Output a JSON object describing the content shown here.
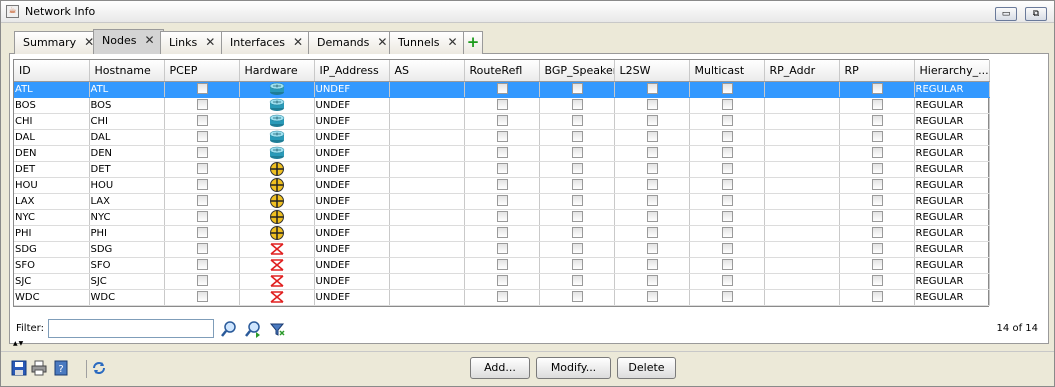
{
  "window": {
    "title": "Network Info",
    "minimize_label": "▭",
    "restore_label": "⧉"
  },
  "tabs": [
    {
      "label": "Summary",
      "close": "✕"
    },
    {
      "label": "Nodes",
      "close": "✕"
    },
    {
      "label": "Links",
      "close": "✕"
    },
    {
      "label": "Interfaces",
      "close": "✕"
    },
    {
      "label": "Demands",
      "close": "✕"
    },
    {
      "label": "Tunnels",
      "close": "✕"
    }
  ],
  "add_tab_label": "+",
  "table": {
    "columns": [
      "ID",
      "Hostname",
      "PCEP",
      "Hardware",
      "IP_Address",
      "AS",
      "RouteRefl",
      "BGP_Speaker",
      "L2SW",
      "Multicast",
      "RP_Addr",
      "RP",
      "Hierarchy_..."
    ],
    "rows": [
      {
        "id": "ATL",
        "hostname": "ATL",
        "hardware": "router-icon",
        "ip": "UNDEF",
        "hierarchy": "REGULAR",
        "selected": true
      },
      {
        "id": "BOS",
        "hostname": "BOS",
        "hardware": "router-icon",
        "ip": "UNDEF",
        "hierarchy": "REGULAR"
      },
      {
        "id": "CHI",
        "hostname": "CHI",
        "hardware": "router-icon",
        "ip": "UNDEF",
        "hierarchy": "REGULAR"
      },
      {
        "id": "DAL",
        "hostname": "DAL",
        "hardware": "router-icon",
        "ip": "UNDEF",
        "hierarchy": "REGULAR"
      },
      {
        "id": "DEN",
        "hostname": "DEN",
        "hardware": "router-icon",
        "ip": "UNDEF",
        "hierarchy": "REGULAR"
      },
      {
        "id": "DET",
        "hostname": "DET",
        "hardware": "crosshair-icon",
        "ip": "UNDEF",
        "hierarchy": "REGULAR"
      },
      {
        "id": "HOU",
        "hostname": "HOU",
        "hardware": "crosshair-icon",
        "ip": "UNDEF",
        "hierarchy": "REGULAR"
      },
      {
        "id": "LAX",
        "hostname": "LAX",
        "hardware": "crosshair-icon",
        "ip": "UNDEF",
        "hierarchy": "REGULAR"
      },
      {
        "id": "NYC",
        "hostname": "NYC",
        "hardware": "crosshair-icon",
        "ip": "UNDEF",
        "hierarchy": "REGULAR"
      },
      {
        "id": "PHI",
        "hostname": "PHI",
        "hardware": "crosshair-icon",
        "ip": "UNDEF",
        "hierarchy": "REGULAR"
      },
      {
        "id": "SDG",
        "hostname": "SDG",
        "hardware": "bowtie-icon",
        "ip": "UNDEF",
        "hierarchy": "REGULAR"
      },
      {
        "id": "SFO",
        "hostname": "SFO",
        "hardware": "bowtie-icon",
        "ip": "UNDEF",
        "hierarchy": "REGULAR"
      },
      {
        "id": "SJC",
        "hostname": "SJC",
        "hardware": "bowtie-icon",
        "ip": "UNDEF",
        "hierarchy": "REGULAR"
      },
      {
        "id": "WDC",
        "hostname": "WDC",
        "hardware": "bowtie-icon",
        "ip": "UNDEF",
        "hierarchy": "REGULAR"
      }
    ]
  },
  "filter": {
    "label": "Filter:",
    "value": "",
    "placeholder": ""
  },
  "row_count": "14 of 14",
  "buttons": {
    "add": "Add...",
    "modify": "Modify...",
    "delete": "Delete"
  },
  "colors": {
    "selection": "#3399ff",
    "add_tab": "#1a9a1a",
    "router": "#2a9ab8",
    "crosshair": "#f0c020",
    "bowtie": "#e02020"
  }
}
